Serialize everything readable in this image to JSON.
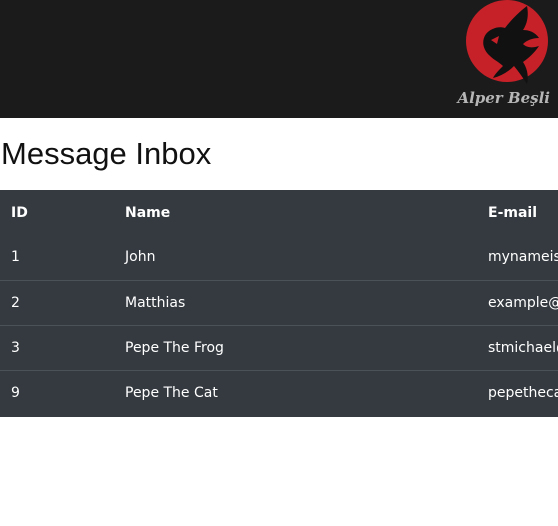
{
  "banner": {
    "brand": "Alper Beşli"
  },
  "page": {
    "title": "Message Inbox"
  },
  "table": {
    "headers": {
      "id": "ID",
      "name": "Name",
      "email": "E-mail"
    },
    "rows": [
      {
        "id": "1",
        "name": "John",
        "email": "mynameisj"
      },
      {
        "id": "2",
        "name": "Matthias",
        "email": "example@"
      },
      {
        "id": "3",
        "name": "Pepe The Frog",
        "email": "stmichael@"
      },
      {
        "id": "9",
        "name": "Pepe The Cat",
        "email": "pepetheca"
      }
    ]
  },
  "colors": {
    "banner_bg": "#1b1b1b",
    "logo_red": "#c62128",
    "table_bg": "#343a40"
  },
  "icons": {
    "logo": "dragon-logo-icon"
  }
}
